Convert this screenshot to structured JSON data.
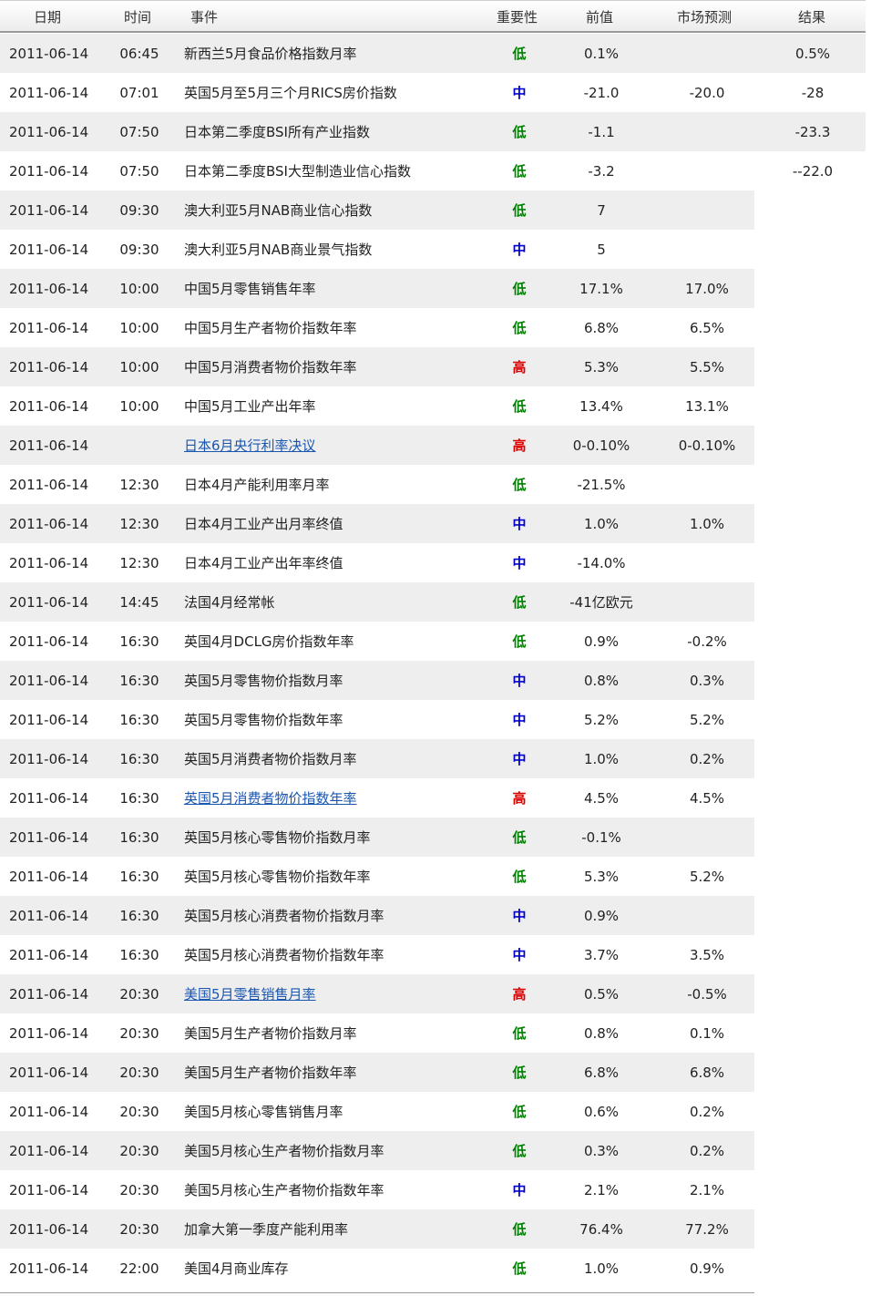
{
  "header": {
    "date": "日期",
    "time": "时间",
    "event": "事件",
    "importance": "重要性",
    "previous": "前值",
    "forecast": "市场预测",
    "actual": "结果"
  },
  "importance_colors": {
    "低": "#008000",
    "中": "#0000cc",
    "高": "#dd0000"
  },
  "link_color": "#1a56b0",
  "rows": [
    {
      "date": "2011-06-14",
      "time": "06:45",
      "event": "新西兰5月食品价格指数月率",
      "importance": "低",
      "previous": "0.1%",
      "forecast": "",
      "actual": "0.5%",
      "link": false
    },
    {
      "date": "2011-06-14",
      "time": "07:01",
      "event": "英国5月至5月三个月RICS房价指数",
      "importance": "中",
      "previous": "-21.0",
      "forecast": "-20.0",
      "actual": "-28",
      "link": false
    },
    {
      "date": "2011-06-14",
      "time": "07:50",
      "event": "日本第二季度BSI所有产业指数",
      "importance": "低",
      "previous": "-1.1",
      "forecast": "",
      "actual": "-23.3",
      "link": false
    },
    {
      "date": "2011-06-14",
      "time": "07:50",
      "event": "日本第二季度BSI大型制造业信心指数",
      "importance": "低",
      "previous": "-3.2",
      "forecast": "",
      "actual": "--22.0",
      "link": false
    },
    {
      "date": "2011-06-14",
      "time": "09:30",
      "event": "澳大利亚5月NAB商业信心指数",
      "importance": "低",
      "previous": "7",
      "forecast": "",
      "actual": "",
      "link": false
    },
    {
      "date": "2011-06-14",
      "time": "09:30",
      "event": "澳大利亚5月NAB商业景气指数",
      "importance": "中",
      "previous": "5",
      "forecast": "",
      "actual": "",
      "link": false
    },
    {
      "date": "2011-06-14",
      "time": "10:00",
      "event": "中国5月零售销售年率",
      "importance": "低",
      "previous": "17.1%",
      "forecast": "17.0%",
      "actual": "",
      "link": false
    },
    {
      "date": "2011-06-14",
      "time": "10:00",
      "event": "中国5月生产者物价指数年率",
      "importance": "低",
      "previous": "6.8%",
      "forecast": "6.5%",
      "actual": "",
      "link": false
    },
    {
      "date": "2011-06-14",
      "time": "10:00",
      "event": "中国5月消费者物价指数年率",
      "importance": "高",
      "previous": "5.3%",
      "forecast": "5.5%",
      "actual": "",
      "link": false
    },
    {
      "date": "2011-06-14",
      "time": "10:00",
      "event": "中国5月工业产出年率",
      "importance": "低",
      "previous": "13.4%",
      "forecast": "13.1%",
      "actual": "",
      "link": false
    },
    {
      "date": "2011-06-14",
      "time": "",
      "event": "日本6月央行利率决议",
      "importance": "高",
      "previous": "0-0.10%",
      "forecast": "0-0.10%",
      "actual": "",
      "link": true
    },
    {
      "date": "2011-06-14",
      "time": "12:30",
      "event": "日本4月产能利用率月率",
      "importance": "低",
      "previous": "-21.5%",
      "forecast": "",
      "actual": "",
      "link": false
    },
    {
      "date": "2011-06-14",
      "time": "12:30",
      "event": "日本4月工业产出月率终值",
      "importance": "中",
      "previous": "1.0%",
      "forecast": "1.0%",
      "actual": "",
      "link": false
    },
    {
      "date": "2011-06-14",
      "time": "12:30",
      "event": "日本4月工业产出年率终值",
      "importance": "中",
      "previous": "-14.0%",
      "forecast": "",
      "actual": "",
      "link": false
    },
    {
      "date": "2011-06-14",
      "time": "14:45",
      "event": "法国4月经常帐",
      "importance": "低",
      "previous": "-41亿欧元",
      "forecast": "",
      "actual": "",
      "link": false
    },
    {
      "date": "2011-06-14",
      "time": "16:30",
      "event": "英国4月DCLG房价指数年率",
      "importance": "低",
      "previous": "0.9%",
      "forecast": "-0.2%",
      "actual": "",
      "link": false
    },
    {
      "date": "2011-06-14",
      "time": "16:30",
      "event": "英国5月零售物价指数月率",
      "importance": "中",
      "previous": "0.8%",
      "forecast": "0.3%",
      "actual": "",
      "link": false
    },
    {
      "date": "2011-06-14",
      "time": "16:30",
      "event": "英国5月零售物价指数年率",
      "importance": "中",
      "previous": "5.2%",
      "forecast": "5.2%",
      "actual": "",
      "link": false
    },
    {
      "date": "2011-06-14",
      "time": "16:30",
      "event": "英国5月消费者物价指数月率",
      "importance": "中",
      "previous": "1.0%",
      "forecast": "0.2%",
      "actual": "",
      "link": false
    },
    {
      "date": "2011-06-14",
      "time": "16:30",
      "event": "英国5月消费者物价指数年率",
      "importance": "高",
      "previous": "4.5%",
      "forecast": "4.5%",
      "actual": "",
      "link": true
    },
    {
      "date": "2011-06-14",
      "time": "16:30",
      "event": "英国5月核心零售物价指数月率",
      "importance": "低",
      "previous": "-0.1%",
      "forecast": "",
      "actual": "",
      "link": false
    },
    {
      "date": "2011-06-14",
      "time": "16:30",
      "event": "英国5月核心零售物价指数年率",
      "importance": "低",
      "previous": "5.3%",
      "forecast": "5.2%",
      "actual": "",
      "link": false
    },
    {
      "date": "2011-06-14",
      "time": "16:30",
      "event": "英国5月核心消费者物价指数月率",
      "importance": "中",
      "previous": "0.9%",
      "forecast": "",
      "actual": "",
      "link": false
    },
    {
      "date": "2011-06-14",
      "time": "16:30",
      "event": "英国5月核心消费者物价指数年率",
      "importance": "中",
      "previous": "3.7%",
      "forecast": "3.5%",
      "actual": "",
      "link": false
    },
    {
      "date": "2011-06-14",
      "time": "20:30",
      "event": "美国5月零售销售月率",
      "importance": "高",
      "previous": "0.5%",
      "forecast": "-0.5%",
      "actual": "",
      "link": true
    },
    {
      "date": "2011-06-14",
      "time": "20:30",
      "event": "美国5月生产者物价指数月率",
      "importance": "低",
      "previous": "0.8%",
      "forecast": "0.1%",
      "actual": "",
      "link": false
    },
    {
      "date": "2011-06-14",
      "time": "20:30",
      "event": "美国5月生产者物价指数年率",
      "importance": "低",
      "previous": "6.8%",
      "forecast": "6.8%",
      "actual": "",
      "link": false
    },
    {
      "date": "2011-06-14",
      "time": "20:30",
      "event": "美国5月核心零售销售月率",
      "importance": "低",
      "previous": "0.6%",
      "forecast": "0.2%",
      "actual": "",
      "link": false
    },
    {
      "date": "2011-06-14",
      "time": "20:30",
      "event": "美国5月核心生产者物价指数月率",
      "importance": "低",
      "previous": "0.3%",
      "forecast": "0.2%",
      "actual": "",
      "link": false
    },
    {
      "date": "2011-06-14",
      "time": "20:30",
      "event": "美国5月核心生产者物价指数年率",
      "importance": "中",
      "previous": "2.1%",
      "forecast": "2.1%",
      "actual": "",
      "link": false
    },
    {
      "date": "2011-06-14",
      "time": "20:30",
      "event": "加拿大第一季度产能利用率",
      "importance": "低",
      "previous": "76.4%",
      "forecast": "77.2%",
      "actual": "",
      "link": false
    },
    {
      "date": "2011-06-14",
      "time": "22:00",
      "event": "美国4月商业库存",
      "importance": "低",
      "previous": "1.0%",
      "forecast": "0.9%",
      "actual": "",
      "link": false
    }
  ]
}
